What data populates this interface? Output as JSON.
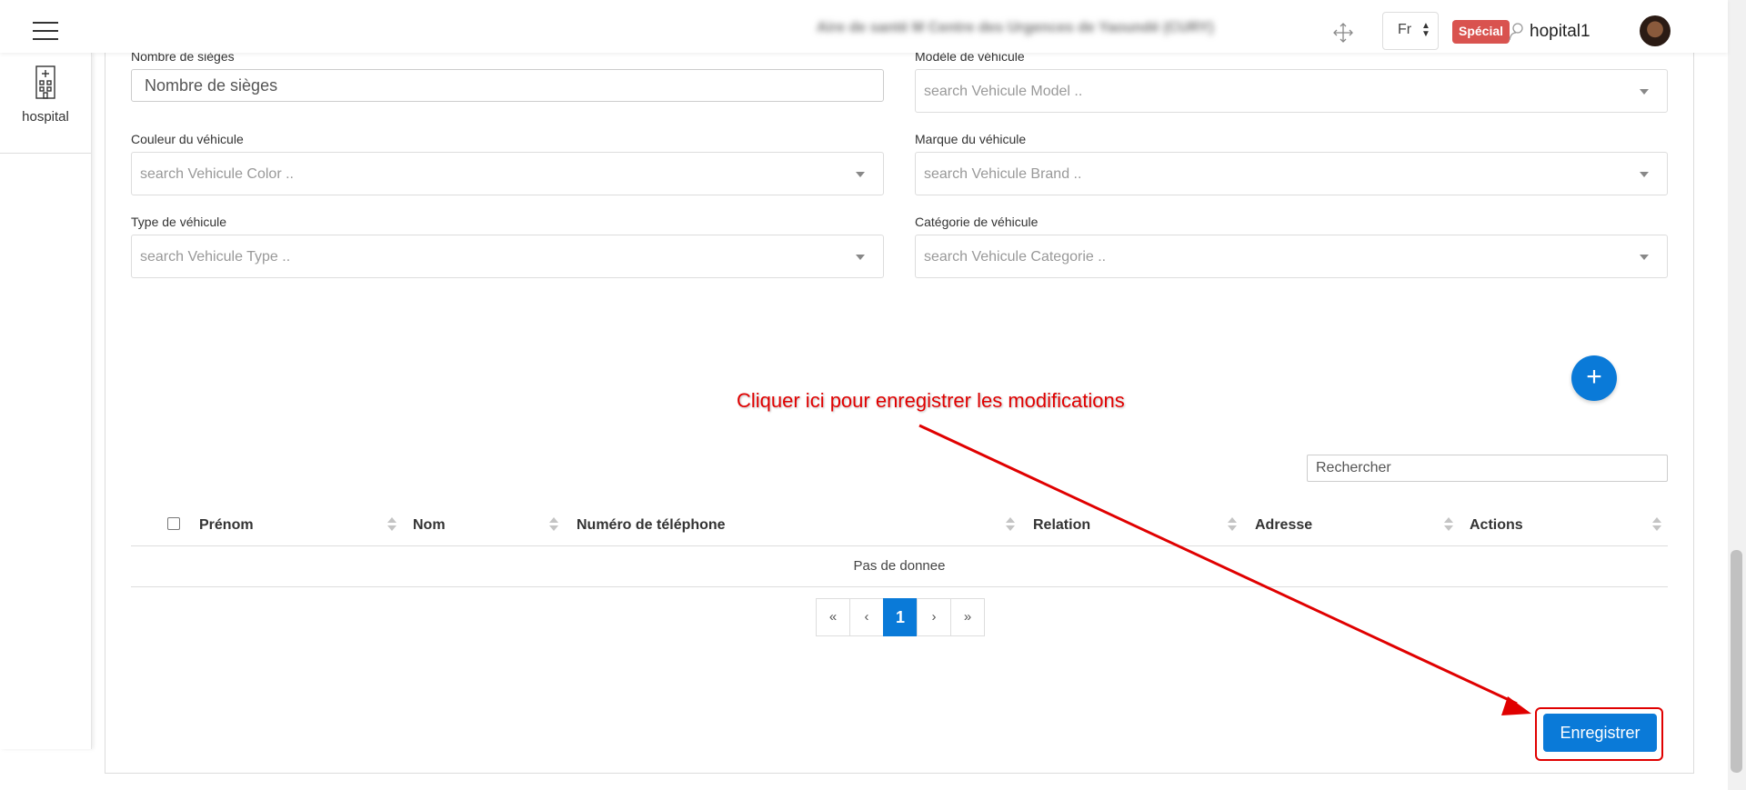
{
  "header": {
    "org_name": "Aire de santé M Centre des Urgences de Yaoundé (CURY)",
    "language": "Fr",
    "special_badge": "Spécial",
    "username": "hopital1"
  },
  "sidebar": {
    "items": [
      {
        "label": "hospital",
        "icon": "hospital-icon"
      }
    ]
  },
  "form": {
    "seats": {
      "label": "Nombre de sièges",
      "placeholder": "Nombre de sièges"
    },
    "model": {
      "label": "Modèle de véhicule",
      "placeholder": "search Vehicule Model .."
    },
    "color": {
      "label": "Couleur du véhicule",
      "placeholder": "search Vehicule Color .."
    },
    "brand": {
      "label": "Marque du véhicule",
      "placeholder": "search Vehicule Brand .."
    },
    "type": {
      "label": "Type de véhicule",
      "placeholder": "search Vehicule Type .."
    },
    "category": {
      "label": "Catégorie de véhicule",
      "placeholder": "search Vehicule Categorie .."
    }
  },
  "add_button": {
    "label": "+"
  },
  "search": {
    "placeholder": "Rechercher"
  },
  "table": {
    "columns": [
      "Prénom",
      "Nom",
      "Numéro de téléphone",
      "Relation",
      "Adresse",
      "Actions"
    ],
    "empty_message": "Pas de donnee"
  },
  "pagination": {
    "first": "«",
    "prev": "‹",
    "current": "1",
    "next": "›",
    "last": "»"
  },
  "save_button": {
    "label": "Enregistrer"
  },
  "annotation": {
    "text": "Cliquer ici pour enregistrer les modifications",
    "color": "#e00000"
  },
  "colors": {
    "primary": "#0a7ad8",
    "badge": "#d9534f"
  }
}
